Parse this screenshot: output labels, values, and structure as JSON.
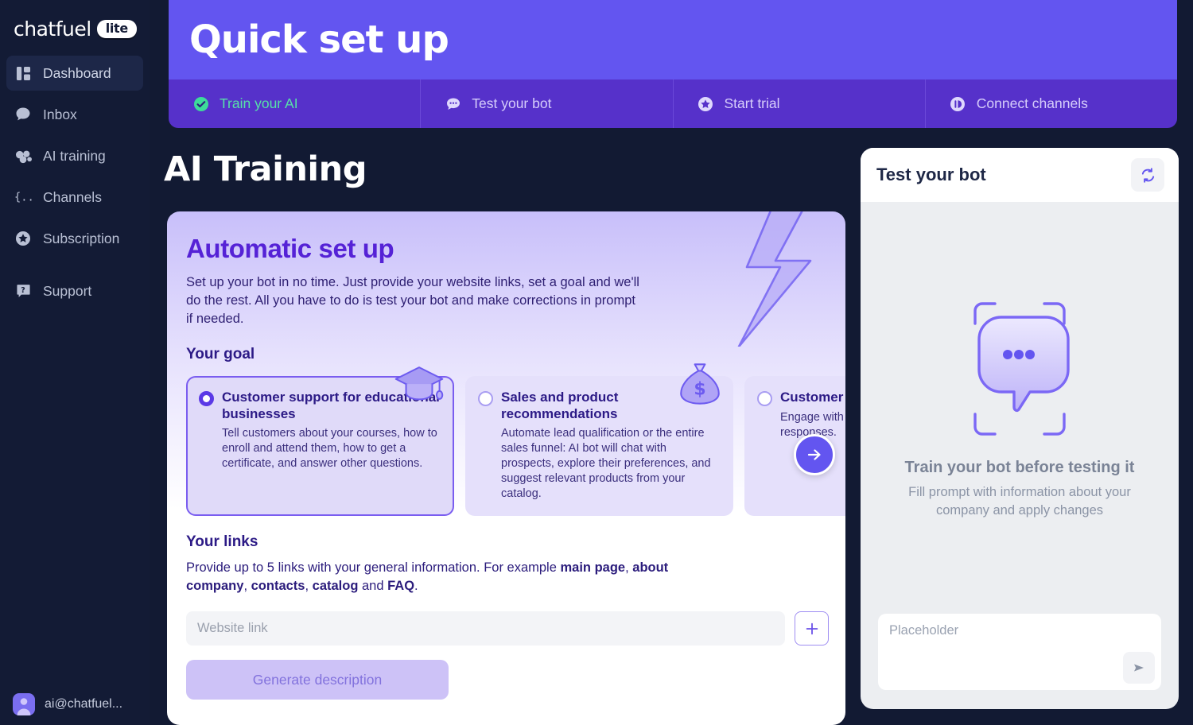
{
  "brand": {
    "name": "chatfuel",
    "badge": "lite"
  },
  "sidebar": {
    "items": [
      {
        "label": "Dashboard",
        "icon": "dashboard-icon",
        "active": true
      },
      {
        "label": "Inbox",
        "icon": "inbox-chat-icon",
        "active": false
      },
      {
        "label": "AI training",
        "icon": "ai-training-icon",
        "active": false
      },
      {
        "label": "Channels",
        "icon": "channels-braces-icon",
        "active": false
      },
      {
        "label": "Subscription",
        "icon": "star-badge-icon",
        "active": false
      }
    ],
    "support": {
      "label": "Support",
      "icon": "question-bubble-icon"
    },
    "user": {
      "email": "ai@chatfuel...",
      "icon": "avatar-person-icon"
    }
  },
  "banner": {
    "title": "Quick set up",
    "tabs": [
      {
        "label": "Train your AI",
        "icon": "check-circle-icon",
        "state": "done"
      },
      {
        "label": "Test your bot",
        "icon": "chat-dots-icon",
        "state": "todo"
      },
      {
        "label": "Start trial",
        "icon": "star-circle-icon",
        "state": "todo"
      },
      {
        "label": "Connect channels",
        "icon": "plug-circle-icon",
        "state": "todo"
      }
    ]
  },
  "main": {
    "page_title": "AI Training",
    "auto_card": {
      "heading": "Automatic set up",
      "paragraph": "Set up your bot in no time. Just provide your website links, set a goal and we'll do the rest. All you have to do is test your bot and make corrections in prompt if needed.",
      "goal_section_title": "Your goal",
      "goals": [
        {
          "title": "Customer support for educational businesses",
          "desc": "Tell customers about your courses, how to enroll and attend them, how to get a certificate, and answer other questions.",
          "emoji": "graduation-cap-icon",
          "selected": true
        },
        {
          "title": "Sales and product recommendations",
          "desc": "Automate lead qualification or the entire sales funnel: AI bot will chat with prospects, explore their preferences, and suggest relevant products from your catalog.",
          "emoji": "money-bag-icon",
          "selected": false
        },
        {
          "title": "Customer s",
          "desc": "Engage with y automa lly. info wi custo acc responses.",
          "emoji": "",
          "selected": false
        }
      ],
      "links_section_title": "Your links",
      "links_hint_prefix": "Provide up to 5 links with your general information. For example ",
      "links_hint_bold1": "main page",
      "links_hint_mid1": ", ",
      "links_hint_bold2": "about company",
      "links_hint_mid2": ", ",
      "links_hint_bold3": "contacts",
      "links_hint_mid3": ", ",
      "links_hint_bold4": "catalog",
      "links_hint_mid4": " and ",
      "links_hint_bold5": "FAQ",
      "links_hint_suffix": ".",
      "link_input_value": "",
      "link_input_placeholder": "Website link",
      "add_button_label": "+",
      "generate_button_label": "Generate description",
      "next_arrow_icon": "arrow-right-icon"
    }
  },
  "test_panel": {
    "title": "Test your bot",
    "refresh_icon": "refresh-icon",
    "empty_icon": "chat-scan-icon",
    "empty_title": "Train your bot before testing it",
    "empty_sub": "Fill prompt with information about your company and apply changes",
    "input_placeholder": "Placeholder",
    "send_icon": "send-icon"
  },
  "colors": {
    "banner_purple": "#6355f0",
    "tabbar_purple": "#5631ca",
    "sidebar_navy": "#131b35",
    "page_bg": "#121a33",
    "accent_violet": "#5522d6",
    "success_green": "#57e0a8"
  }
}
